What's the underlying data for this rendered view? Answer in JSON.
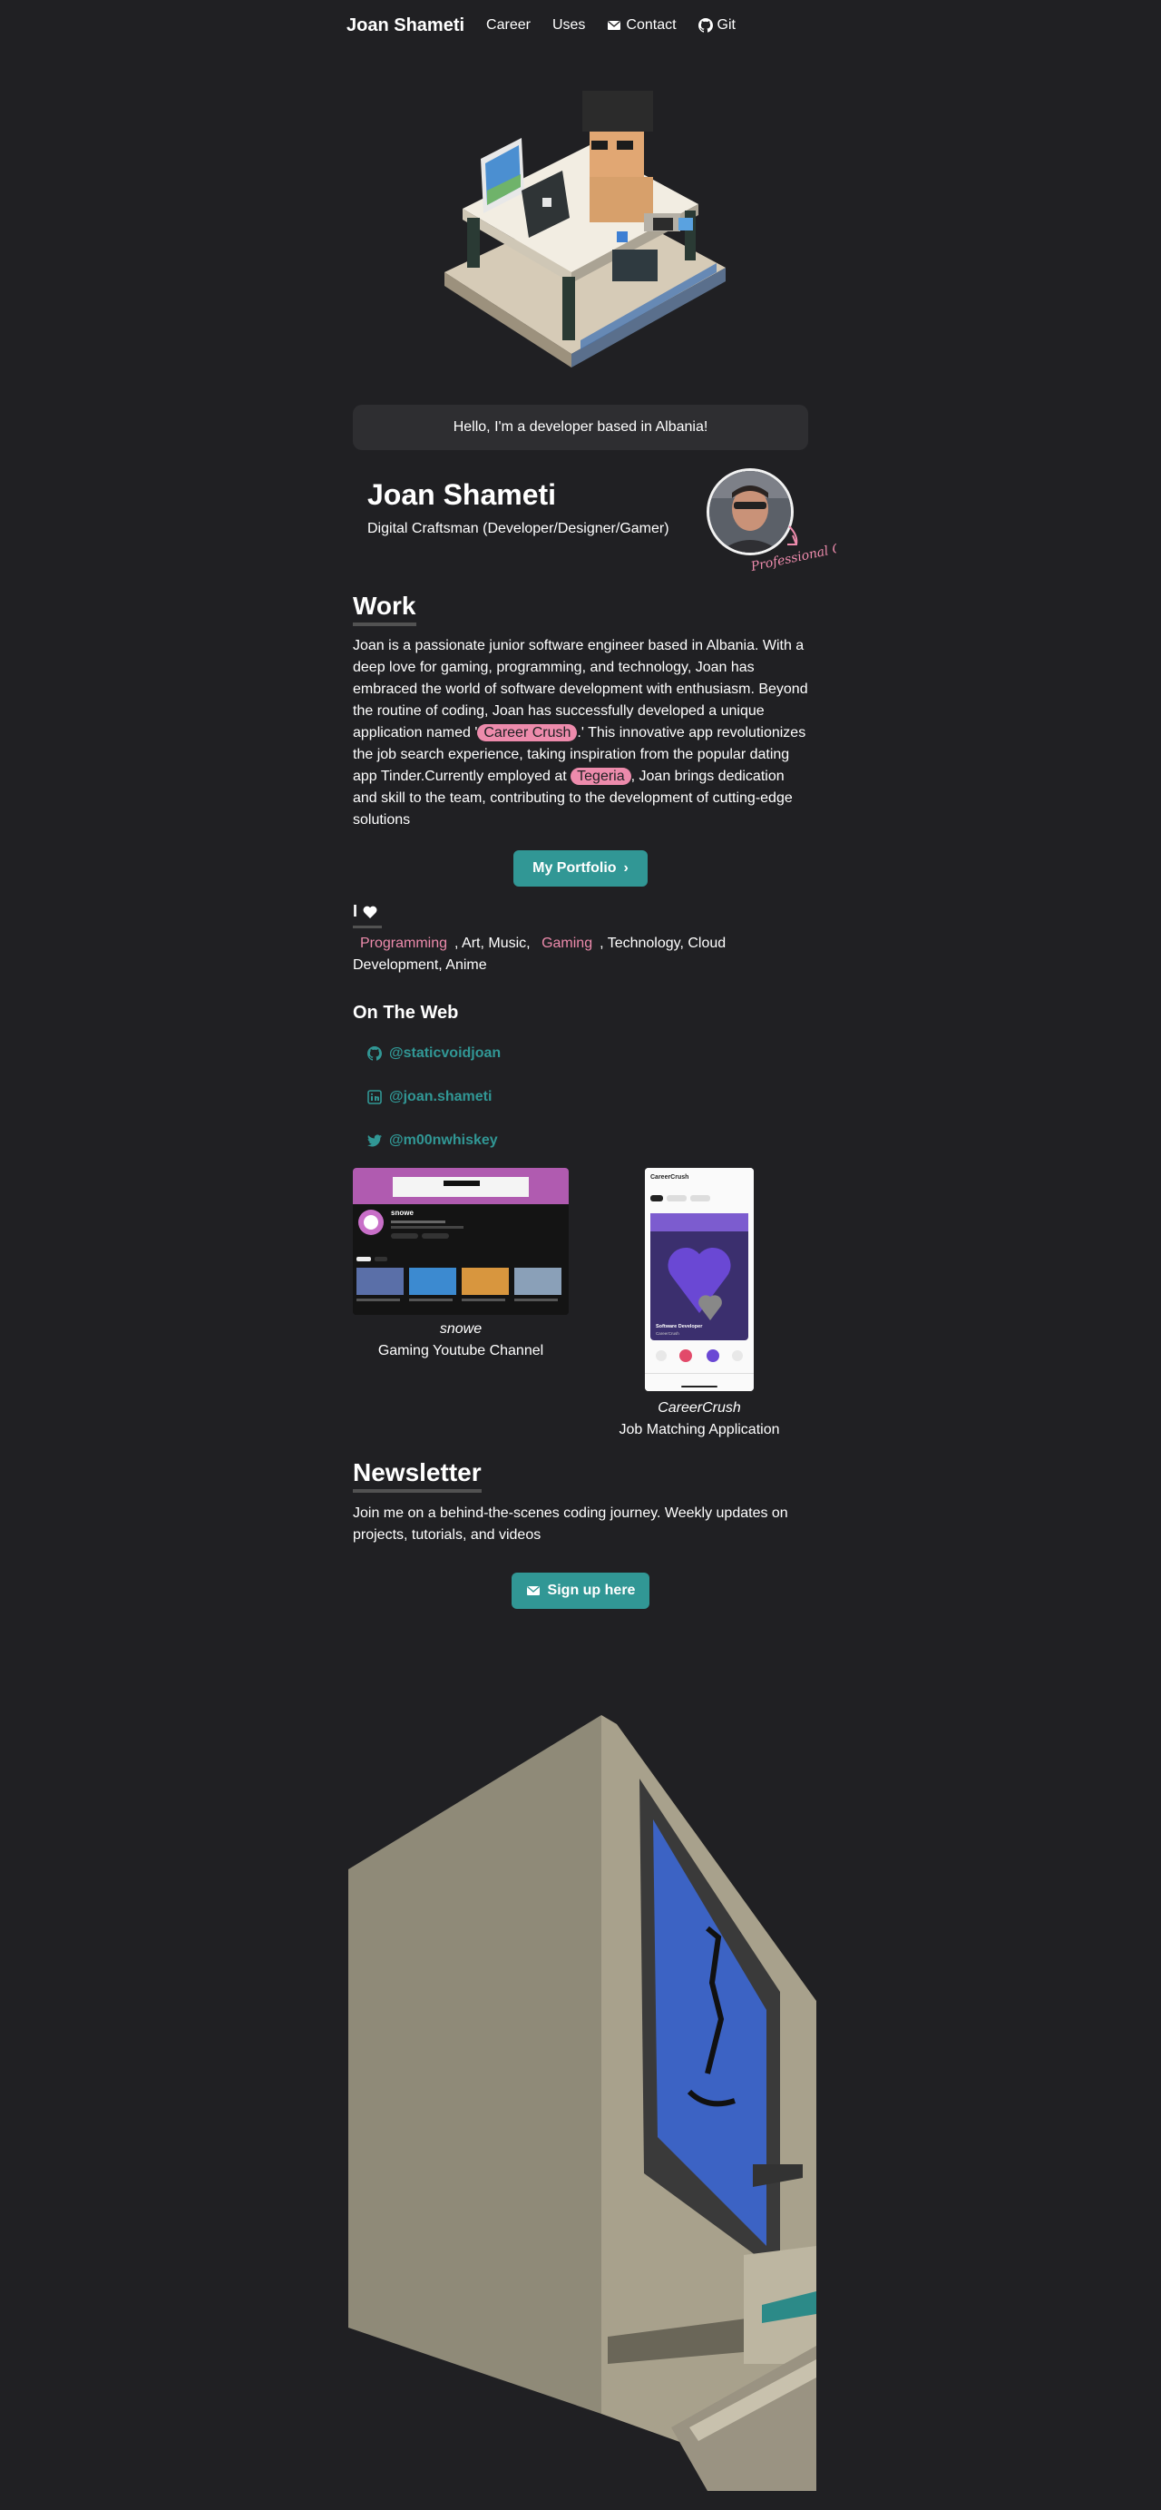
{
  "nav": {
    "brand": "Joan Shameti",
    "links": [
      {
        "label": "Career",
        "icon": null
      },
      {
        "label": "Uses",
        "icon": null
      },
      {
        "label": "Contact",
        "icon": "envelope-icon"
      },
      {
        "label": "Git",
        "icon": "github-icon"
      }
    ]
  },
  "greeting": "Hello, I'm a developer based in Albania!",
  "profile": {
    "name": "Joan Shameti",
    "role": "Digital Craftsman (Developer/Designer/Gamer)",
    "annotation": "Professional Cage fighter"
  },
  "work": {
    "heading": "Work",
    "p1": "Joan is a passionate junior software engineer based in Albania. With a deep love for gaming, programming, and technology, Joan has embraced the world of software development with enthusiasm. Beyond the routine of coding, Joan has successfully developed a unique application named '",
    "pill1": "Career Crush",
    "p2": ".' This innovative app revolutionizes the job search experience, taking inspiration from the popular dating app Tinder.Currently employed at",
    "pill2": "Tegeria",
    "p3": ", Joan brings dedication and skill to the team, contributing to the development of cutting-edge solutions",
    "button": "My Portfolio"
  },
  "loves": {
    "heading": "I",
    "hl1": "Programming",
    "t1": ", Art, Music,",
    "hl2": "Gaming",
    "t2": ", Technology, Cloud Development, Anime"
  },
  "web": {
    "heading": "On The Web",
    "links": [
      {
        "label": "@staticvoidjoan",
        "icon": "github-icon"
      },
      {
        "label": "@joan.shameti",
        "icon": "linkedin-icon"
      },
      {
        "label": "@m00nwhiskey",
        "icon": "twitter-icon"
      }
    ]
  },
  "projects": [
    {
      "title": "snowe",
      "subtitle": "Gaming Youtube Channel"
    },
    {
      "title": "CareerCrush",
      "subtitle": "Job Matching Application"
    }
  ],
  "thumbs": {
    "yt_channel": "snowe",
    "cc_brand": "CareerCrush",
    "cc_job": "Software Developer",
    "cc_company": "CareerCrush"
  },
  "newsletter": {
    "heading": "Newsletter",
    "text": "Join me on a behind-the-scenes coding journey. Weekly updates on projects, tutorials, and videos",
    "button": "Sign up here"
  },
  "colors": {
    "bg": "#202023",
    "accent": "#319795",
    "pink": "#ed8bac"
  }
}
